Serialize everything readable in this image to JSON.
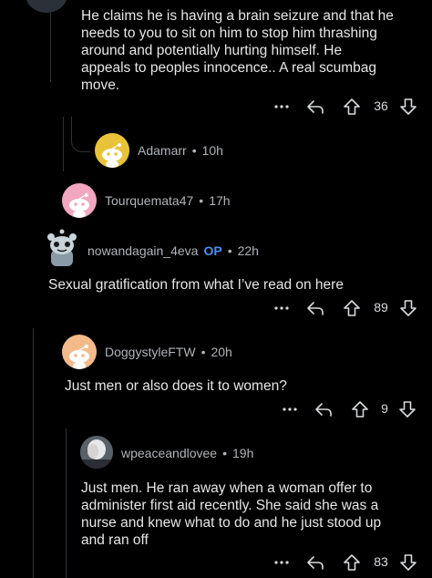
{
  "comments": [
    {
      "body": "He claims he is having a brain seizure and that he needs to you to sit on him to stop him thrashing around and potentially hurting himself. He appeals to peoples innocence.. A real scumbag move.",
      "body_lines": [
        "He claims he is having a brain seizure and that he",
        "needs to you to sit on him to stop him thrashing",
        "around and potentially hurting himself. He",
        "appeals to peoples innocence.. A real scumbag",
        "move."
      ],
      "votes": "36"
    },
    {
      "username": "Adamarr",
      "time": "10h",
      "collapsed": true
    },
    {
      "username": "Tourquemata47",
      "time": "17h",
      "collapsed": true
    },
    {
      "username": "nowandagain_4eva",
      "badge": "OP",
      "time": "22h",
      "body_lines": [
        "Sexual gratification from what I’ve read on here"
      ],
      "votes": "89"
    },
    {
      "username": "DoggystyleFTW",
      "time": "20h",
      "body_lines": [
        "Just men or also does it to women?"
      ],
      "votes": "9"
    },
    {
      "username": "wpeaceandlovee",
      "time": "19h",
      "body_lines": [
        "Just men. He ran away when a woman offer to",
        "administer first aid recently. She said she was a",
        "nurse and knew what to do and he just stood up",
        "and ran off"
      ],
      "votes": "83"
    }
  ],
  "separator": "•",
  "icons": {
    "more": "more-options-icon",
    "reply": "reply-icon",
    "upvote": "upvote-icon",
    "downvote": "downvote-icon"
  },
  "colors": {
    "background": "#000000",
    "op_badge": "#4a8ef0",
    "thread_line": "#2f3336"
  }
}
